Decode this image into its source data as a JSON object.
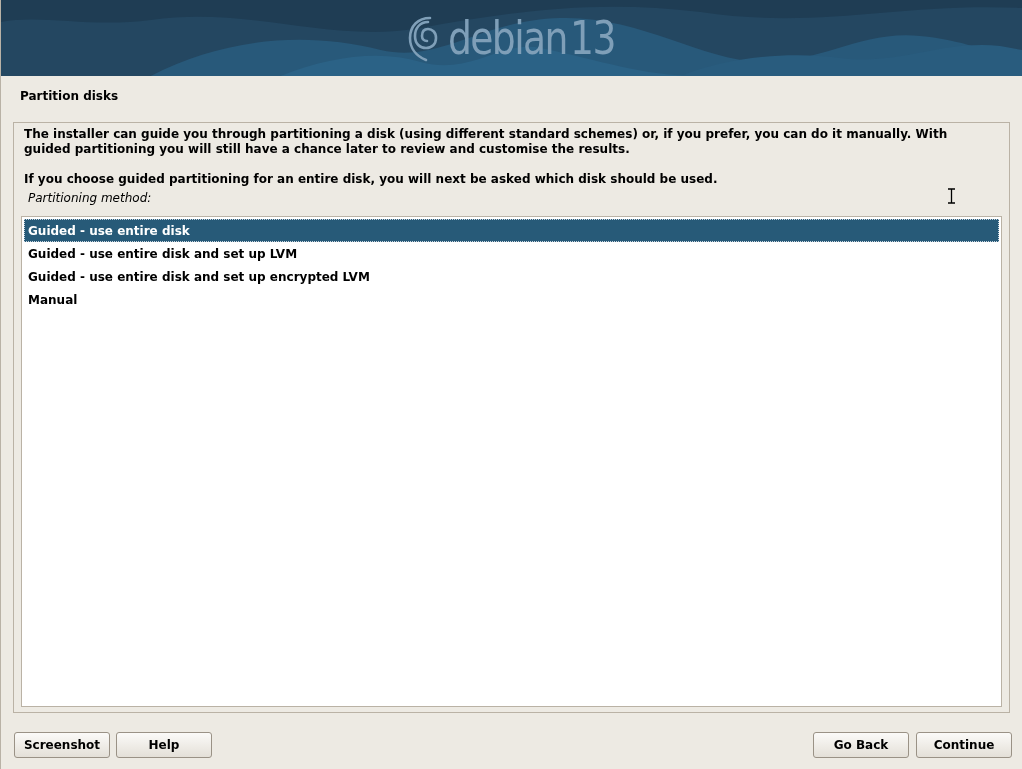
{
  "banner": {
    "logo_name": "debian",
    "logo_version": "13"
  },
  "title": "Partition disks",
  "paragraphs": [
    "The installer can guide you through partitioning a disk (using different standard schemes) or, if you prefer, you can do it manually. With guided partitioning you will still have a chance later to review and customise the results.",
    "If you choose guided partitioning for an entire disk, you will next be asked which disk should be used."
  ],
  "list_label": "Partitioning method:",
  "options": [
    {
      "label": "Guided - use entire disk",
      "selected": true
    },
    {
      "label": "Guided - use entire disk and set up LVM",
      "selected": false
    },
    {
      "label": "Guided - use entire disk and set up encrypted LVM",
      "selected": false
    },
    {
      "label": "Manual",
      "selected": false
    }
  ],
  "buttons_left": [
    "Screenshot",
    "Help"
  ],
  "buttons_right": [
    "Go Back",
    "Continue"
  ]
}
